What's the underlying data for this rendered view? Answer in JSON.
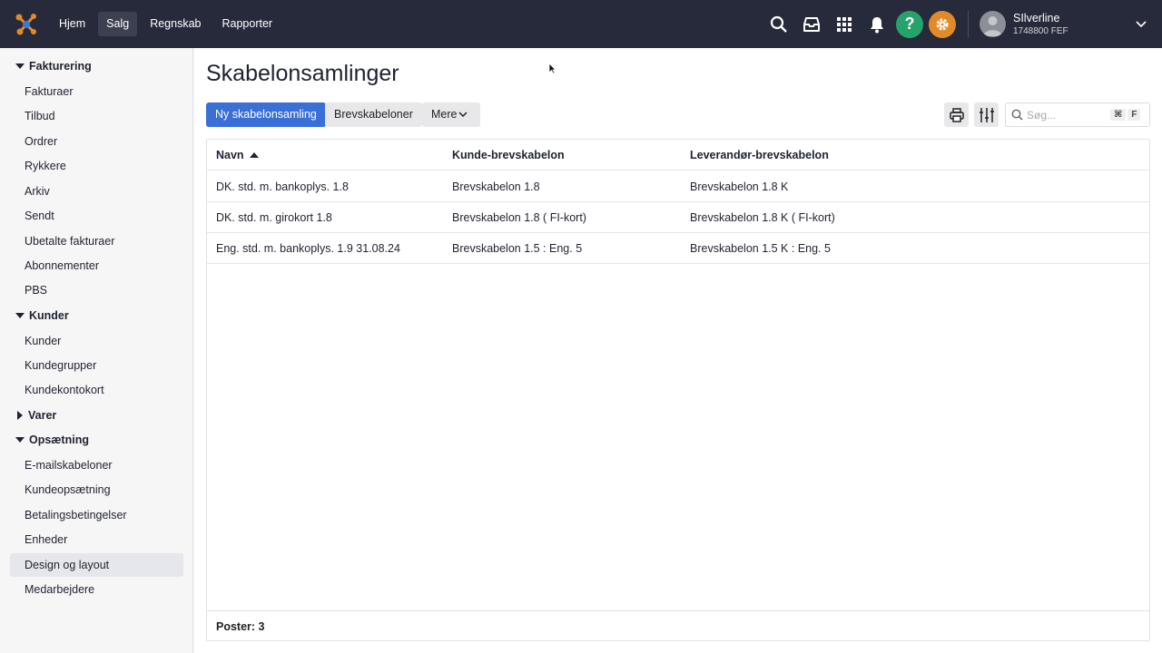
{
  "topnav": {
    "items": [
      {
        "label": "Hjem",
        "active": false
      },
      {
        "label": "Salg",
        "active": true
      },
      {
        "label": "Regnskab",
        "active": false
      },
      {
        "label": "Rapporter",
        "active": false
      }
    ],
    "icons": [
      "search-icon",
      "inbox-icon",
      "apps-grid-icon",
      "bell-icon",
      "help-icon",
      "gear-icon"
    ],
    "help_label": "?",
    "user": {
      "name": "SIlverline",
      "id": "1748800 FEF"
    },
    "colors": {
      "bar": "#272a3a",
      "help": "#25a36b",
      "gear": "#e28a2a"
    }
  },
  "sidebar": {
    "sections": [
      {
        "label": "Fakturering",
        "expanded": true,
        "items": [
          "Fakturaer",
          "Tilbud",
          "Ordrer",
          "Rykkere",
          "Arkiv",
          "Sendt",
          "Ubetalte fakturaer",
          "Abonnementer",
          "PBS"
        ]
      },
      {
        "label": "Kunder",
        "expanded": true,
        "items": [
          "Kunder",
          "Kundegrupper",
          "Kundekontokort"
        ]
      },
      {
        "label": "Varer",
        "expanded": false,
        "items": []
      },
      {
        "label": "Opsætning",
        "expanded": true,
        "items": [
          "E-mailskabeloner",
          "Kundeopsætning",
          "Betalingsbetingelser",
          "Enheder",
          "Design og layout",
          "Medarbejdere"
        ]
      }
    ],
    "active_item": "Design og layout"
  },
  "main": {
    "title": "Skabelonsamlinger",
    "buttons": {
      "new": "Ny skabelonsamling",
      "letter_templates": "Brevskabeloner",
      "more": "Mere"
    },
    "search": {
      "placeholder": "Søg...",
      "shortcut_mod": "⌘",
      "shortcut_key": "F"
    },
    "table": {
      "columns": [
        "Navn",
        "Kunde-brevskabelon",
        "Leverandør-brevskabelon"
      ],
      "sort": {
        "column": "Navn",
        "direction": "asc"
      },
      "rows": [
        [
          "DK. std. m. bankoplys. 1.8",
          "Brevskabelon 1.8",
          "Brevskabelon 1.8 K"
        ],
        [
          "DK. std. m. girokort 1.8",
          "Brevskabelon 1.8 ( FI-kort)",
          "Brevskabelon 1.8 K ( FI-kort)"
        ],
        [
          "Eng. std. m. bankoplys. 1.9 31.08.24",
          "Brevskabelon 1.5 : Eng. 5",
          "Brevskabelon 1.5 K : Eng. 5"
        ]
      ],
      "footer": "Poster: 3"
    },
    "accent": "#3a6fd8"
  }
}
